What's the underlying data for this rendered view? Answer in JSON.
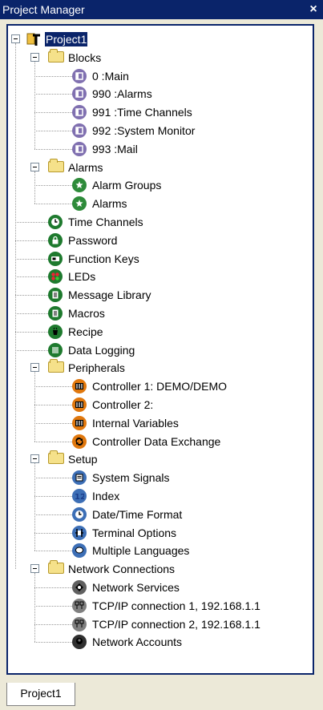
{
  "window": {
    "title": "Project Manager",
    "close_glyph": "×"
  },
  "tree": [
    {
      "label": "Project1",
      "level": 0,
      "icon": "project-icon",
      "expander": true,
      "selected": true
    },
    {
      "label": "Blocks",
      "level": 1,
      "icon": "folder-icon",
      "expander": true
    },
    {
      "label": "0 :Main",
      "level": 2,
      "icon": "block-icon",
      "color": "#8070B0"
    },
    {
      "label": "990 :Alarms",
      "level": 2,
      "icon": "block-icon",
      "color": "#8070B0"
    },
    {
      "label": "991 :Time Channels",
      "level": 2,
      "icon": "block-icon",
      "color": "#8070B0"
    },
    {
      "label": "992 :System Monitor",
      "level": 2,
      "icon": "block-icon",
      "color": "#8070B0"
    },
    {
      "label": "993 :Mail",
      "level": 2,
      "icon": "block-icon",
      "color": "#8070B0"
    },
    {
      "label": "Alarms",
      "level": 1,
      "icon": "folder-icon",
      "expander": true
    },
    {
      "label": "Alarm Groups",
      "level": 2,
      "icon": "alarm-groups-icon",
      "color": "#2E8B3A"
    },
    {
      "label": "Alarms",
      "level": 2,
      "icon": "alarm-icon",
      "color": "#2E8B3A"
    },
    {
      "label": "Time Channels",
      "level": 1,
      "icon": "clock-icon",
      "color": "#1E7A2E"
    },
    {
      "label": "Password",
      "level": 1,
      "icon": "lock-icon",
      "color": "#1E7A2E"
    },
    {
      "label": "Function Keys",
      "level": 1,
      "icon": "key-icon",
      "color": "#1E7A2E"
    },
    {
      "label": "LEDs",
      "level": 1,
      "icon": "leds-icon",
      "color": "#1E7A2E"
    },
    {
      "label": "Message Library",
      "level": 1,
      "icon": "message-library-icon",
      "color": "#1E7A2E"
    },
    {
      "label": "Macros",
      "level": 1,
      "icon": "macros-icon",
      "color": "#1E7A2E"
    },
    {
      "label": "Recipe",
      "level": 1,
      "icon": "recipe-icon",
      "color": "#1E7A2E"
    },
    {
      "label": "Data Logging",
      "level": 1,
      "icon": "data-logging-icon",
      "color": "#1E7A2E"
    },
    {
      "label": "Peripherals",
      "level": 1,
      "icon": "folder-icon",
      "expander": true
    },
    {
      "label": "Controller 1: DEMO/DEMO",
      "level": 2,
      "icon": "controller-icon",
      "color": "#E0780E"
    },
    {
      "label": "Controller 2:",
      "level": 2,
      "icon": "controller-icon",
      "color": "#E0780E"
    },
    {
      "label": "Internal Variables",
      "level": 2,
      "icon": "controller-icon",
      "color": "#E0780E"
    },
    {
      "label": "Controller Data Exchange",
      "level": 2,
      "icon": "data-exchange-icon",
      "color": "#E0780E"
    },
    {
      "label": "Setup",
      "level": 1,
      "icon": "folder-icon",
      "expander": true
    },
    {
      "label": "System Signals",
      "level": 2,
      "icon": "system-signals-icon",
      "color": "#3D6FB6"
    },
    {
      "label": "Index",
      "level": 2,
      "icon": "index-icon",
      "color": "#3D6FB6"
    },
    {
      "label": "Date/Time Format",
      "level": 2,
      "icon": "clock-icon",
      "color": "#3D6FB6"
    },
    {
      "label": "Terminal Options",
      "level": 2,
      "icon": "terminal-options-icon",
      "color": "#3D6FB6"
    },
    {
      "label": "Multiple Languages",
      "level": 2,
      "icon": "languages-icon",
      "color": "#3D6FB6"
    },
    {
      "label": "Network Connections",
      "level": 1,
      "icon": "folder-icon",
      "expander": true
    },
    {
      "label": "Network Services",
      "level": 2,
      "icon": "network-services-icon",
      "color": "#606060"
    },
    {
      "label": "TCP/IP connection 1, 192.168.1.1",
      "level": 2,
      "icon": "tcpip-icon",
      "color": "#808080"
    },
    {
      "label": "TCP/IP connection 2, 192.168.1.1",
      "level": 2,
      "icon": "tcpip-icon",
      "color": "#808080"
    },
    {
      "label": "Network Accounts",
      "level": 2,
      "icon": "network-accounts-icon",
      "color": "#303030"
    }
  ],
  "tabs": [
    {
      "label": "Project1"
    }
  ]
}
